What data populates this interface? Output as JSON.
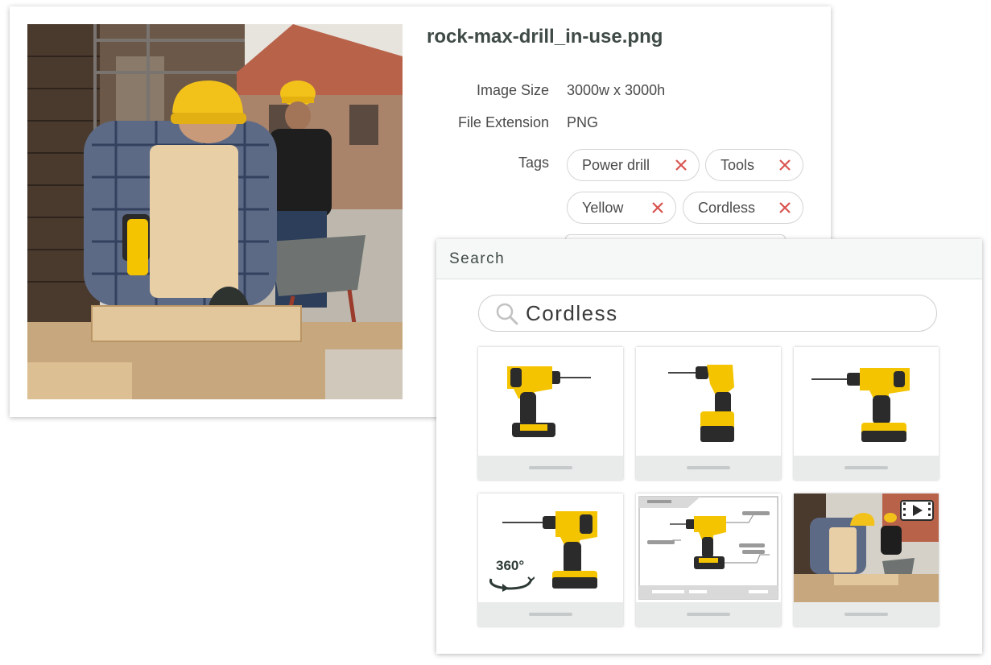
{
  "asset": {
    "filename": "rock-max-drill_in-use.png",
    "image_size_label": "Image Size",
    "image_size_value": "3000w x 3000h",
    "file_extension_label": "File Extension",
    "file_extension_value": "PNG",
    "tags_label": "Tags",
    "tags": [
      "Power drill",
      "Tools",
      "Yellow",
      "Cordless"
    ],
    "tag_remove_color": "#d9534f"
  },
  "search": {
    "header": "Search",
    "query": "Cordless",
    "icon": "magnifier-icon",
    "results": [
      {
        "type": "image",
        "subject": "drill-facing-right"
      },
      {
        "type": "image",
        "subject": "drill-facing-left"
      },
      {
        "type": "image",
        "subject": "drill-side-view"
      },
      {
        "type": "360-view",
        "badge": "360°",
        "subject": "drill-360"
      },
      {
        "type": "annotated-diagram",
        "subject": "drill-callouts"
      },
      {
        "type": "video",
        "badge_icon": "video-play-icon",
        "subject": "drill-in-use"
      }
    ]
  },
  "colors": {
    "drill_yellow": "#f5c400",
    "drill_dark": "#2b2b2b",
    "hardhat_yellow": "#f2c21a",
    "card_shadow": "#bfc4c4"
  }
}
